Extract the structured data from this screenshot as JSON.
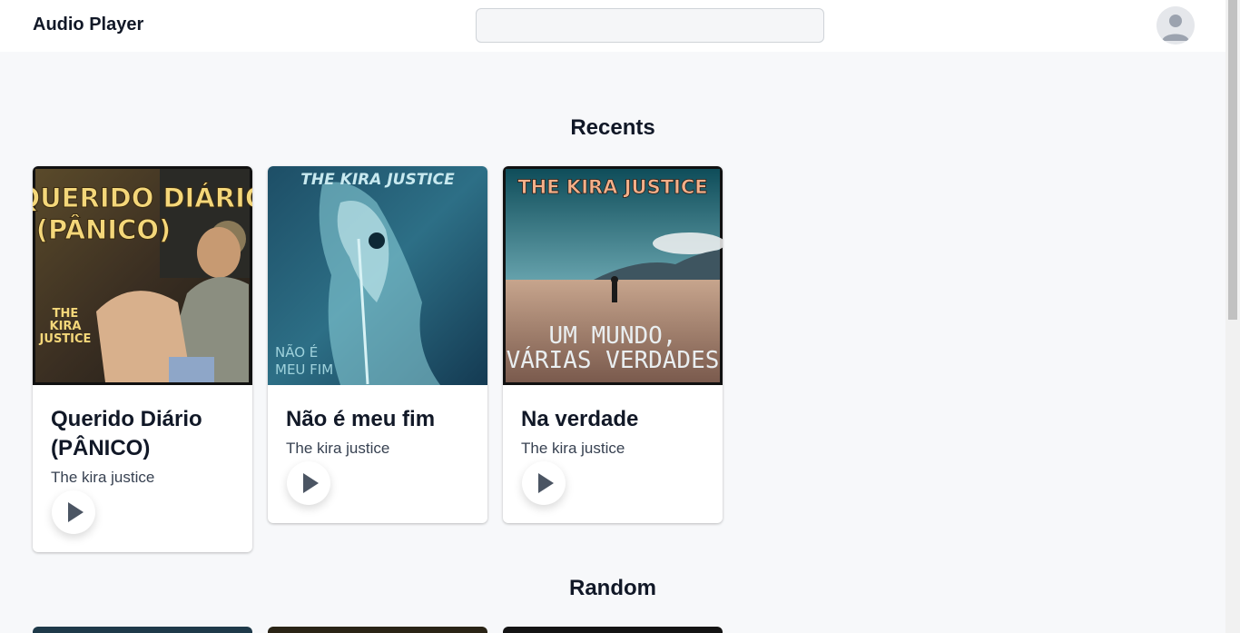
{
  "app": {
    "title": "Audio Player",
    "search_placeholder": ""
  },
  "sections": {
    "recents_title": "Recents",
    "random_title": "Random"
  },
  "recents": [
    {
      "title": "Querido Diário (PÂNICO)",
      "artist": "The kira justice",
      "cover_text_top": "QUERIDO DIÁRIO (PÂNICO)",
      "cover_text_bottom": "THE KIRA JUSTICE"
    },
    {
      "title": "Não é meu fim",
      "artist": "The kira justice",
      "cover_text_top": "THE KIRA JUSTICE",
      "cover_text_bottom": "NÃO É MEU FIM"
    },
    {
      "title": "Na verdade",
      "artist": "The kira justice",
      "cover_text_top": "THE KIRA JUSTICE",
      "cover_text_bottom": "UM MUNDO, VÁRIAS VERDADES"
    }
  ],
  "icons": {
    "avatar": "user-avatar-icon",
    "play": "play-icon"
  },
  "colors": {
    "page_bg": "#f7f8fa",
    "play_icon": "#4b5563"
  }
}
